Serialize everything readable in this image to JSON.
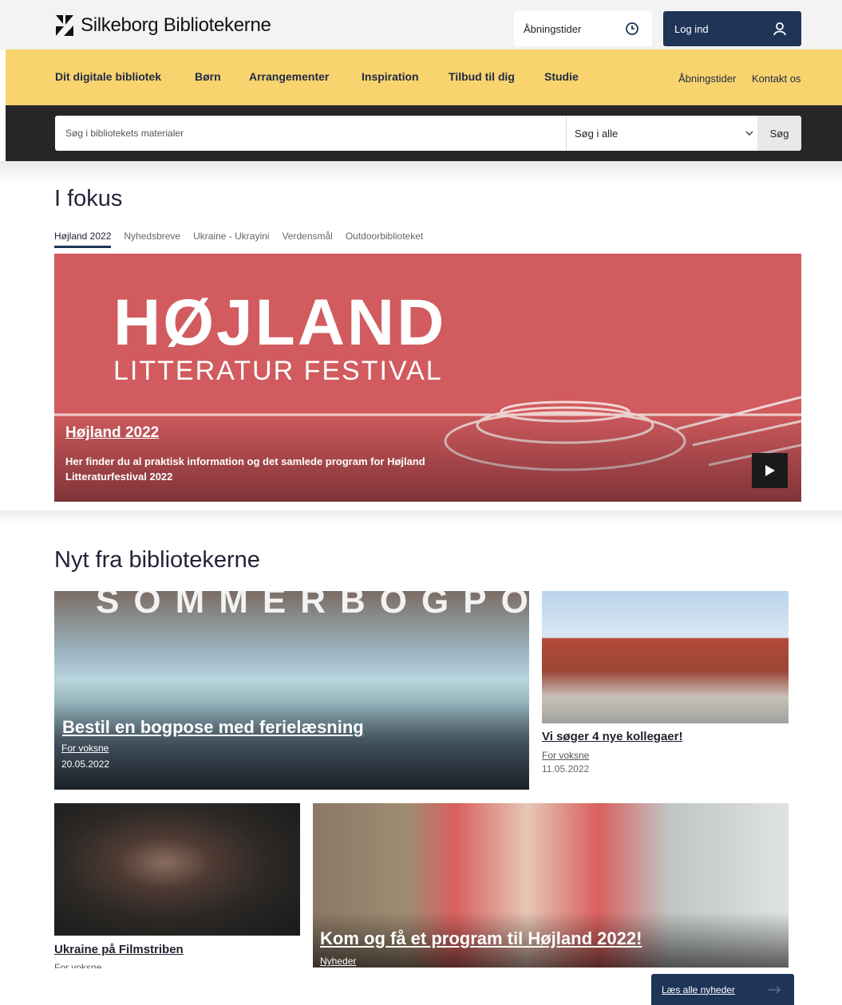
{
  "header": {
    "logo_text": "Silkeborg Bibliotekerne",
    "hours_label": "Åbningstider",
    "login_label": "Log ind"
  },
  "nav": {
    "items": [
      "Dit digitale bibliotek",
      "Børn",
      "Arrangementer",
      "Inspiration",
      "Tilbud til dig",
      "Studie"
    ],
    "right_items": [
      "Åbningstider",
      "Kontakt os"
    ]
  },
  "search": {
    "placeholder": "Søg i bibliotekets materialer",
    "scope": "Søg i alle",
    "button": "Søg"
  },
  "focus": {
    "heading": "I fokus",
    "tabs": [
      "Højland 2022",
      "Nyhedsbreve",
      "Ukraine - Ukrayini",
      "Verdensmål",
      "Outdoorbiblioteket"
    ],
    "hero": {
      "logo_title": "HØJLAND",
      "logo_subtitle": "LITTERATUR FESTIVAL",
      "title": "Højland 2022",
      "text": "Her finder du al praktisk information og det samlede program for Højland Litteraturfestival 2022"
    }
  },
  "news": {
    "heading": "Nyt fra bibliotekerne",
    "cards": [
      {
        "title": "Bestil en bogpose med ferielæsning",
        "tag": "For voksne",
        "date": "20.05.2022",
        "image_text": "SOMMERBOGPOSEN"
      },
      {
        "title": "Vi søger 4 nye kollegaer!",
        "tag": "For voksne",
        "date": "11.05.2022"
      },
      {
        "title": "Ukraine på Filmstriben",
        "tag": "For voksne"
      },
      {
        "title": "Kom og få et program til Højland 2022!",
        "tag": "Nyheder"
      }
    ],
    "read_all": "Læs alle nyheder"
  },
  "colors": {
    "navy": "#1e3558",
    "yellow": "#f8d36e",
    "hero_red": "#d15b5e",
    "dark": "#262626"
  }
}
